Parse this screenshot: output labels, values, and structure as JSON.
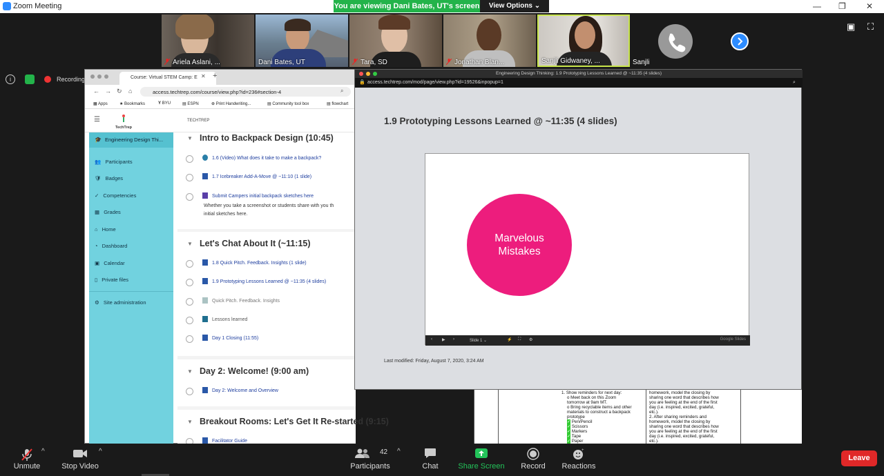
{
  "window": {
    "title": "Zoom Meeting"
  },
  "banner": {
    "viewing_text": "You are viewing Dani Bates, UT's screen",
    "view_options": "View Options"
  },
  "participants_strip": [
    {
      "name": "Ariela Aslani, ...",
      "muted": true
    },
    {
      "name": "Dani Bates, UT",
      "muted": false
    },
    {
      "name": "Tara, SD",
      "muted": true
    },
    {
      "name": "Jonathan Blan...",
      "muted": true
    },
    {
      "name": "Sanjli Gidwaney, ...",
      "muted": false
    },
    {
      "name": "Sanjli",
      "muted": false
    }
  ],
  "status": {
    "recording": "Recording"
  },
  "browser": {
    "tab": "Course: Virtual STEM Camp: E",
    "address": "access.techtrep.com/course/view.php?id=236#section-4",
    "bookmarks": [
      "Apps",
      "Bookmarks",
      "BYU",
      "ESPN",
      "Print Handwriting...",
      "Community tool box",
      "flowchart"
    ],
    "site_logo": "TechTrep",
    "site_nav": "TECHTREP",
    "sidebar": [
      "Engineering Design Thi...",
      "Participants",
      "Badges",
      "Competencies",
      "Grades",
      "Home",
      "Dashboard",
      "Calendar",
      "Private files",
      "Site administration"
    ],
    "sections": [
      {
        "title": "Intro to Backpack Design (10:45)",
        "activities": [
          "1.6 (Video) What does it take to make a backpack?",
          "1.7 Icebreaker Add-A-Move @ ~11:10 (1 slide)",
          "Submit Campers initial backpack sketches here"
        ],
        "note_line1": "Whether you take a screenshot or students share with you th",
        "note_line2": "initial sketches here."
      },
      {
        "title": "Let's Chat About It (~11:15)",
        "activities": [
          "1.8 Quick Pitch. Feedback. Insights (1 slide)",
          "1.9 Prototyping Lessons Learned @ ~11:35 (4 slides)",
          "Quick Pitch. Feedback. Insights",
          "Lessons learned",
          "Day 1 Closing (11:55)"
        ]
      },
      {
        "title": "Day 2: Welcome! (9:00 am)",
        "activities": [
          "Day 2: Welcome and Overview"
        ]
      },
      {
        "title": "Breakout Rooms: Let's Get It Re-started (9:15)",
        "activities": [
          "Facilitator Guide"
        ]
      }
    ]
  },
  "share_window": {
    "title": "Engineering Design Thinking: 1.9 Prototyping Lessons Learned @ ~11:35 (4 slides)",
    "address": "access.techtrep.com/mod/page/view.php?id=19526&inpopup=1",
    "heading": "1.9 Prototyping Lessons Learned @ ~11:35 (4 slides)",
    "slide_text": "Marvelous Mistakes",
    "slide_label": "Slide 1",
    "slides_brand": "Google Slides",
    "last_modified": "Last modified: Friday, August 7, 2020, 3:24 AM",
    "circle_color": "#ed1d7d"
  },
  "bg_doc": {
    "col1_lines": [
      "1. Show reminders for next day:",
      "o Meet back on this Zoom",
      "tomorrow at 9am MT.",
      "o Bring recyclable items and other",
      "materials to construct a backpack",
      "prototype",
      "Pen/Pencil",
      "Scissors",
      "Markers",
      "Tape",
      "Paper"
    ],
    "col2_lines": [
      "homework, model the closing by",
      "sharing one word that describes how",
      "you are feeling at the end of the first",
      "day (i.e. inspired, excited, grateful,",
      "etc.).",
      "2. After sharing reminders and",
      "homework, model the closing by",
      "sharing one word that describes how",
      "you are feeling at the end of the first",
      "day (i.e. inspired, excited, grateful,",
      "etc.)."
    ]
  },
  "toolbar": {
    "unmute": "Unmute",
    "stop_video": "Stop Video",
    "participants": "Participants",
    "participants_count": "42",
    "chat": "Chat",
    "share_screen": "Share Screen",
    "record": "Record",
    "reactions": "Reactions",
    "leave": "Leave"
  }
}
